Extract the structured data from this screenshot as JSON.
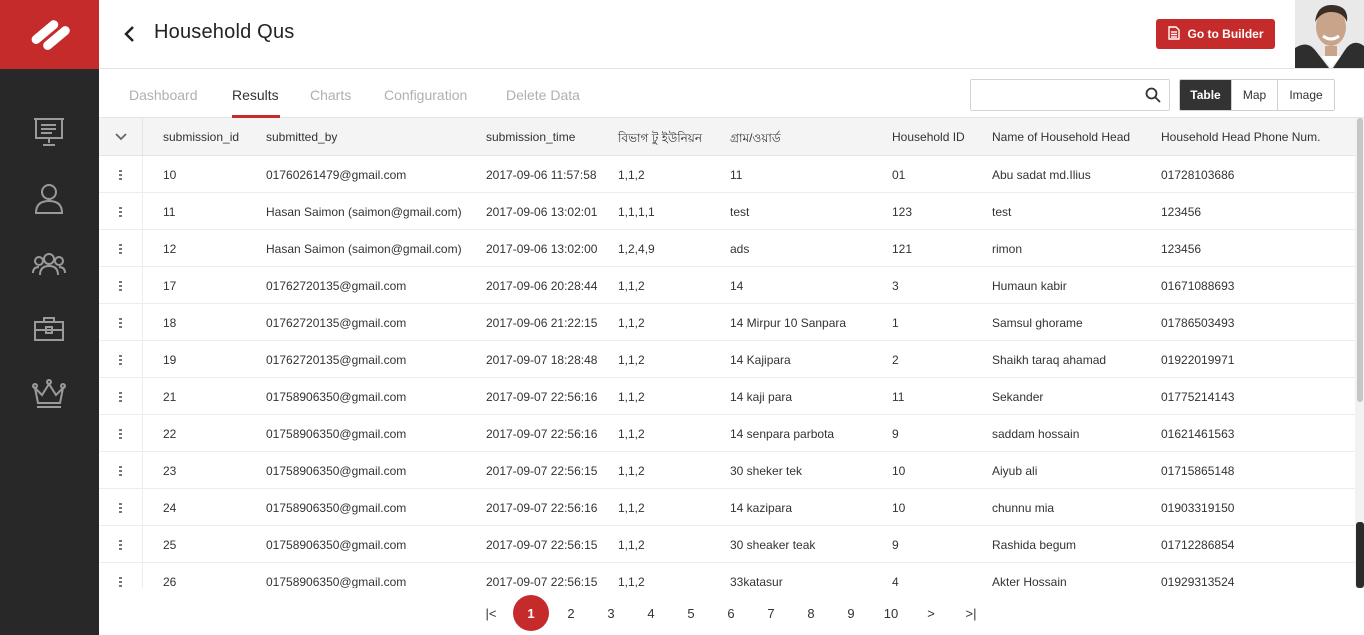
{
  "app": {
    "title": "Household Qus"
  },
  "header": {
    "builder_label": "Go to Builder"
  },
  "tabs": [
    {
      "label": "Dashboard",
      "active": false
    },
    {
      "label": "Results",
      "active": true
    },
    {
      "label": "Charts",
      "active": false
    },
    {
      "label": "Configuration",
      "active": false
    },
    {
      "label": "Delete Data",
      "active": false
    }
  ],
  "search": {
    "value": "",
    "placeholder": ""
  },
  "view_modes": [
    {
      "label": "Table",
      "active": true
    },
    {
      "label": "Map",
      "active": false
    },
    {
      "label": "Image",
      "active": false
    }
  ],
  "table": {
    "columns": [
      "submission_id",
      "submitted_by",
      "submission_time",
      "বিভাগ টু ইউনিয়ন",
      "গ্রাম/ওয়ার্ড",
      "Household ID",
      "Name of Household Head",
      "Household Head Phone Num."
    ],
    "rows": [
      [
        "10",
        "01760261479@gmail.com",
        "2017-09-06 11:57:58",
        "1,1,2",
        "11",
        "01",
        "Abu sadat md.Ilius",
        "01728103686"
      ],
      [
        "11",
        "Hasan Saimon (saimon@gmail.com)",
        "2017-09-06 13:02:01",
        "1,1,1,1",
        "test",
        "123",
        "test",
        "123456"
      ],
      [
        "12",
        "Hasan Saimon (saimon@gmail.com)",
        "2017-09-06 13:02:00",
        "1,2,4,9",
        "ads",
        "121",
        "rimon",
        "123456"
      ],
      [
        "17",
        "01762720135@gmail.com",
        "2017-09-06 20:28:44",
        "1,1,2",
        "14",
        "3",
        "Humaun kabir",
        "01671088693"
      ],
      [
        "18",
        "01762720135@gmail.com",
        "2017-09-06 21:22:15",
        "1,1,2",
        "14 Mirpur 10 Sanpara",
        "1",
        "Samsul ghorame",
        "01786503493"
      ],
      [
        "19",
        "01762720135@gmail.com",
        "2017-09-07 18:28:48",
        "1,1,2",
        "14 Kajipara",
        "2",
        "Shaikh taraq ahamad",
        "01922019971"
      ],
      [
        "21",
        "01758906350@gmail.com",
        "2017-09-07 22:56:16",
        "1,1,2",
        "14 kaji para",
        "11",
        "Sekander",
        "01775214143"
      ],
      [
        "22",
        "01758906350@gmail.com",
        "2017-09-07 22:56:16",
        "1,1,2",
        "14 senpara parbota",
        "9",
        "saddam hossain",
        "01621461563"
      ],
      [
        "23",
        "01758906350@gmail.com",
        "2017-09-07 22:56:15",
        "1,1,2",
        "30 sheker tek",
        "10",
        "Aiyub ali",
        "01715865148"
      ],
      [
        "24",
        "01758906350@gmail.com",
        "2017-09-07 22:56:16",
        "1,1,2",
        "14 kazipara",
        "10",
        "chunnu mia",
        "01903319150"
      ],
      [
        "25",
        "01758906350@gmail.com",
        "2017-09-07 22:56:15",
        "1,1,2",
        "30 sheaker teak",
        "9",
        "Rashida begum",
        "01712286854"
      ],
      [
        "26",
        "01758906350@gmail.com",
        "2017-09-07 22:56:15",
        "1,1,2",
        "33katasur",
        "4",
        "Akter Hossain",
        "01929313524"
      ]
    ]
  },
  "pagination": {
    "first": "|<",
    "pages": [
      "1",
      "2",
      "3",
      "4",
      "5",
      "6",
      "7",
      "8",
      "9",
      "10"
    ],
    "current": "1",
    "next": ">",
    "last": ">|"
  },
  "sidebar": {
    "icons": [
      "presentation-icon",
      "user-icon",
      "users-icon",
      "briefcase-icon",
      "crown-icon"
    ]
  },
  "colors": {
    "brand": "#c62b2b",
    "sidebar": "#282828",
    "active_toggle": "#333333"
  }
}
